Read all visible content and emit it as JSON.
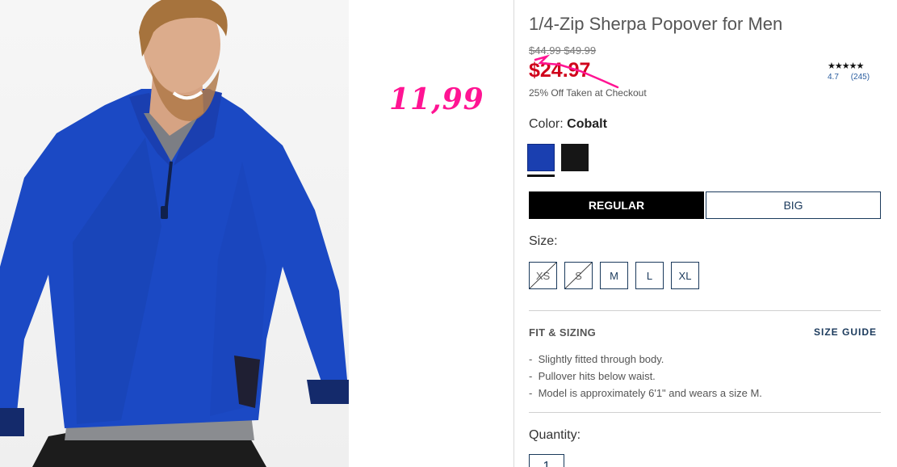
{
  "annotation": {
    "price_note": "11,99"
  },
  "product": {
    "title": "1/4-Zip Sherpa Popover for Men",
    "old_prices": "$44.99 $49.99",
    "sale_price": "$24.97",
    "discount_note": "25% Off Taken at Checkout",
    "rating": {
      "stars": "★★★★★",
      "score": "4.7",
      "count": "(245)"
    }
  },
  "color": {
    "label": "Color:",
    "selected": "Cobalt",
    "swatches": [
      {
        "name": "Cobalt",
        "hex": "#1a3fb0"
      },
      {
        "name": "Black",
        "hex": "#161616"
      }
    ]
  },
  "fit": {
    "options": [
      "REGULAR",
      "BIG"
    ],
    "selected": "REGULAR"
  },
  "size": {
    "label": "Size:",
    "options": [
      {
        "label": "XS",
        "available": false
      },
      {
        "label": "S",
        "available": false
      },
      {
        "label": "M",
        "available": true
      },
      {
        "label": "L",
        "available": true
      },
      {
        "label": "XL",
        "available": true
      }
    ]
  },
  "fit_sizing": {
    "heading": "FIT & SIZING",
    "guide_link": "SIZE GUIDE",
    "bullets": [
      "Slightly fitted through body.",
      "Pullover hits below waist.",
      "Model is approximately 6'1\" and wears a size M."
    ]
  },
  "quantity": {
    "label": "Quantity:",
    "value": "1"
  },
  "colors": {
    "sale_red": "#d0021b",
    "annotation_pink": "#ff1493",
    "navy": "#1b3a5c"
  }
}
